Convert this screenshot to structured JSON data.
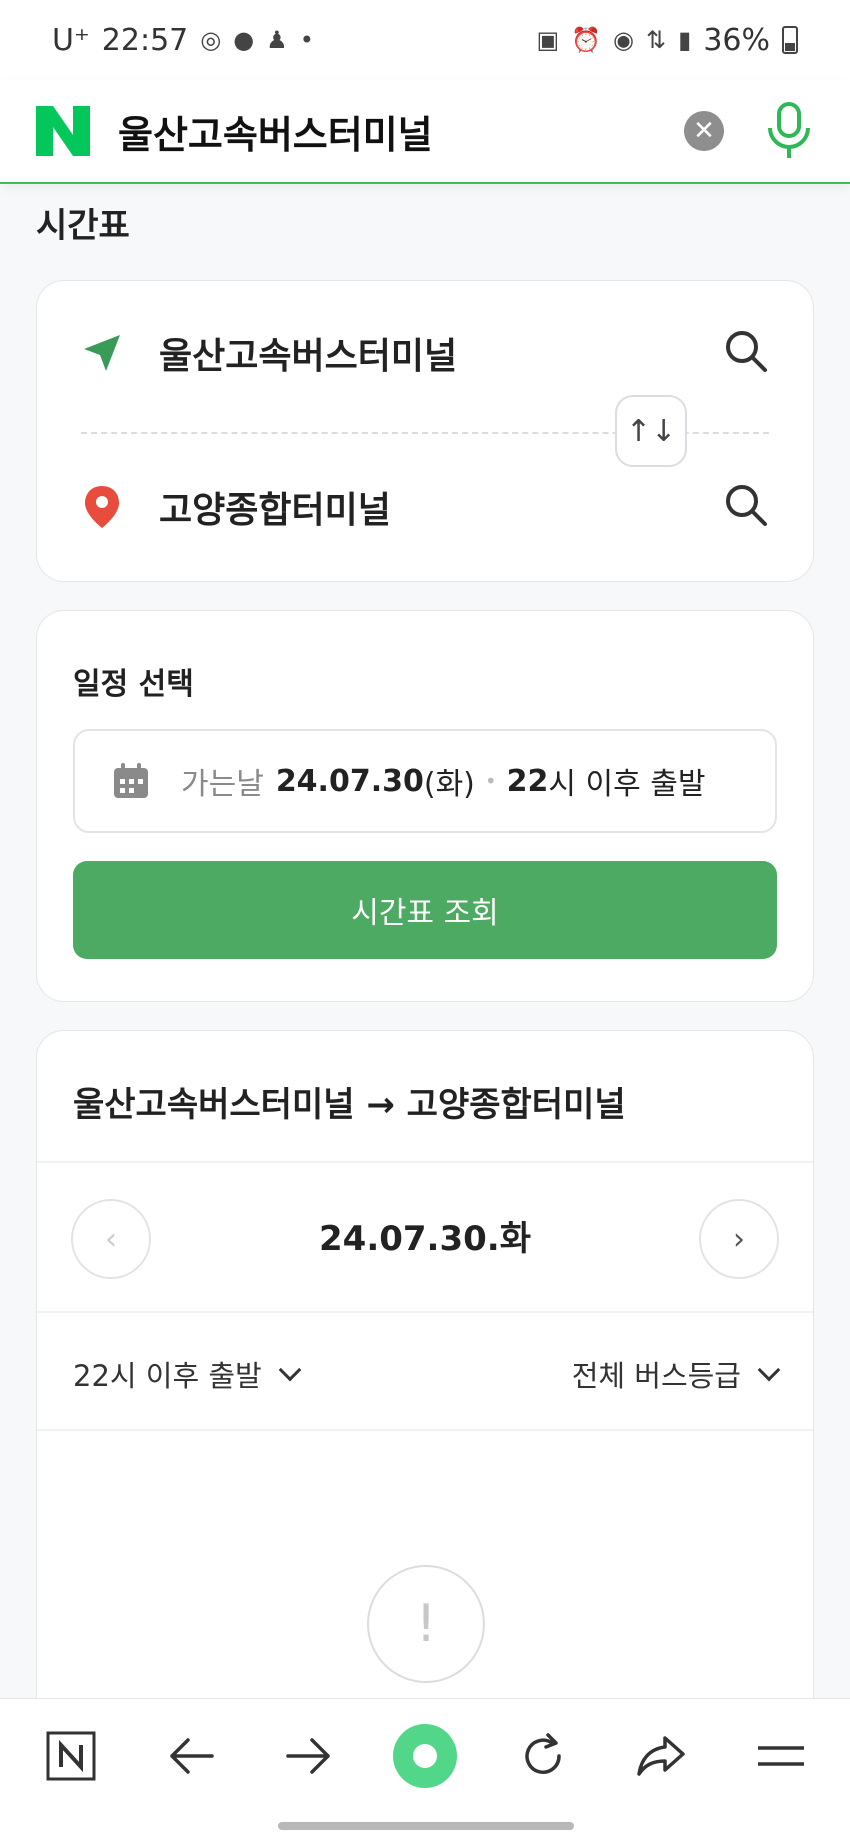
{
  "status_bar": {
    "carrier": "U⁺",
    "time": "22:57",
    "battery": "36%"
  },
  "header": {
    "search_query": "울산고속버스터미널"
  },
  "section_title": "시간표",
  "route": {
    "origin": "울산고속버스터미널",
    "destination": "고양종합터미널"
  },
  "schedule": {
    "label": "일정 선택",
    "date_prefix": "가는날",
    "date": "24.07.30",
    "weekday": "(화)",
    "hour": "22",
    "hour_suffix": "시 이후 출발",
    "button_label": "시간표 조회"
  },
  "results": {
    "route_title": "울산고속버스터미널 → 고양종합터미널",
    "current_date": "24.07.30.화",
    "filter_time": "22시 이후 출발",
    "filter_grade": "전체 버스등급"
  },
  "colors": {
    "accent_green": "#4caa62",
    "naver_green": "#03c75a",
    "pin_red": "#e84c3d"
  }
}
